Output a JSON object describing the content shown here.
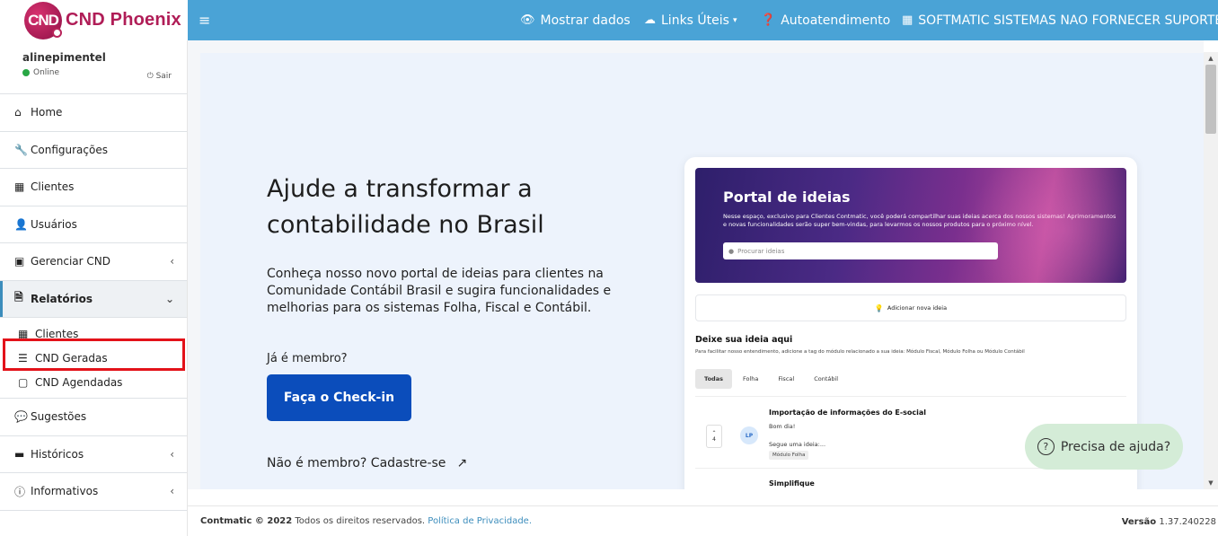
{
  "brand": {
    "logo_text": "CND",
    "name": "CND Phoenix"
  },
  "topbar": {
    "show_data": "Mostrar dados",
    "links": "Links Úteis",
    "self_service": "Autoatendimento",
    "company": "SOFTMATIC SISTEMAS NAO FORNECER SUPORTE"
  },
  "user": {
    "name": "alinepimentel",
    "status": "Online",
    "logout": "Sair"
  },
  "sidebar": {
    "home": "Home",
    "config": "Configurações",
    "clients": "Clientes",
    "users": "Usuários",
    "manage_cnd": "Gerenciar CND",
    "reports": "Relatórios",
    "reports_sub": [
      "Clientes",
      "CND Geradas",
      "CND Agendadas"
    ],
    "suggestions": "Sugestões",
    "history": "Históricos",
    "info": "Informativos"
  },
  "banner": {
    "headline": "Ajude a transformar a contabilidade no Brasil",
    "description": "Conheça nosso novo portal de ideias para clientes na Comunidade Contábil Brasil e sugira funcionalidades e melhorias para os sistemas Folha, Fiscal e Contábil.",
    "member_question": "Já é membro?",
    "checkin": "Faça o Check-in",
    "signup": "Não é membro? Cadastre-se"
  },
  "portal": {
    "title": "Portal de ideias",
    "text": "Nesse espaço, exclusivo para Clientes Contmatic, você poderá compartilhar suas ideias acerca dos nossos sistemas! Aprimoramentos e novas funcionalidades serão super bem-vindas, para levarmos os nossos produtos para o próximo nível.",
    "search_placeholder": "Procurar ideias",
    "add_idea": "Adicionar nova ideia",
    "section_title": "Deixe sua ideia aqui",
    "section_sub": "Para facilitar nosso entendimento, adicione a tag do módulo relacionado a sua ideia: Módulo Fiscal, Módulo Folha ou Módulo Contábil",
    "tabs": [
      "Todas",
      "Folha",
      "Fiscal",
      "Contábil"
    ],
    "ideas": [
      {
        "title": "Importação de informações do E-social",
        "line1": "Bom dia!",
        "line2": "Segue uma ideia:...",
        "tag": "Módulo Folha",
        "votes": "4",
        "avatar": "LP"
      },
      {
        "title": "Simplifique"
      }
    ]
  },
  "help": {
    "label": "Precisa de ajuda?"
  },
  "footer": {
    "copyright": "Contmatic © 2022",
    "rights": " Todos os direitos reservados. ",
    "privacy": "Política de Privacidade.",
    "version_label": "Versão",
    "version": "1.37.240228"
  },
  "colors": {
    "topbar": "#4aa3d6",
    "brand": "#b01d57",
    "checkin": "#0b4dbb",
    "highlight": "#e3121a",
    "help": "#d4ecd7"
  }
}
